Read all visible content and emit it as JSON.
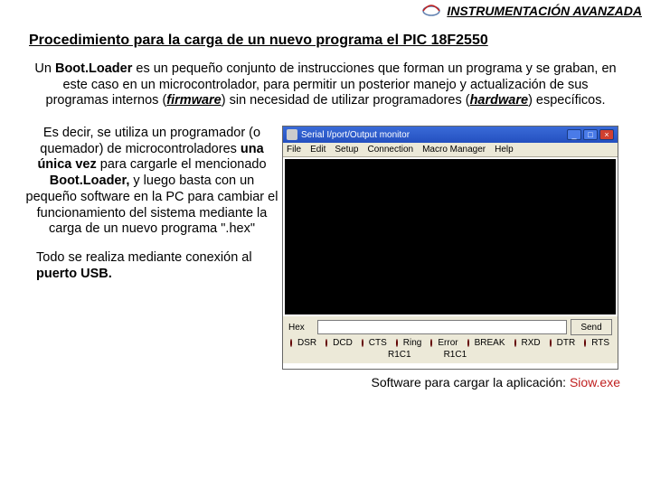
{
  "header": {
    "title": "INSTRUMENTACIÓN AVANZADA"
  },
  "section_title": "Procedimiento para la carga de un nuevo programa el PIC 18F2550",
  "para1_parts": {
    "pre": "Un ",
    "b1": "Boot.Loader",
    "mid1": " es un pequeño conjunto de instrucciones que forman un programa y se graban, en este caso en un microcontrolador, para permitir un posterior manejo y actualización de sus programas internos (",
    "b2": "firmware",
    "mid2": ") sin necesidad de utilizar programadores (",
    "b3": "hardware",
    "post": ") específicos."
  },
  "para2_parts": {
    "a": "Es decir, se utiliza un programador (o quemador) de microcontroladores ",
    "b": "una única vez",
    "c": " para cargarle el mencionado ",
    "d": "Boot.Loader,",
    "e": " y luego basta con un pequeño software en la PC para cambiar el funcionamiento del sistema mediante la carga de un nuevo programa \".hex\""
  },
  "para3_parts": {
    "a": "Todo se realiza mediante conexión al ",
    "b": "puerto USB."
  },
  "screenshot": {
    "title": "Serial I/port/Output monitor",
    "menu": [
      "File",
      "Edit",
      "Setup",
      "Connection",
      "Macro Manager",
      "Help"
    ],
    "hex_label": "Hex",
    "send_label": "Send",
    "leds": [
      "DSR",
      "DCD",
      "CTS",
      "Ring",
      "Error",
      "BREAK",
      "RXD",
      "DTR",
      "RTS"
    ],
    "rx": "R1C1",
    "tx": "R1C1"
  },
  "caption": {
    "text": "Software para cargar la aplicación: ",
    "app": "Siow.exe"
  }
}
